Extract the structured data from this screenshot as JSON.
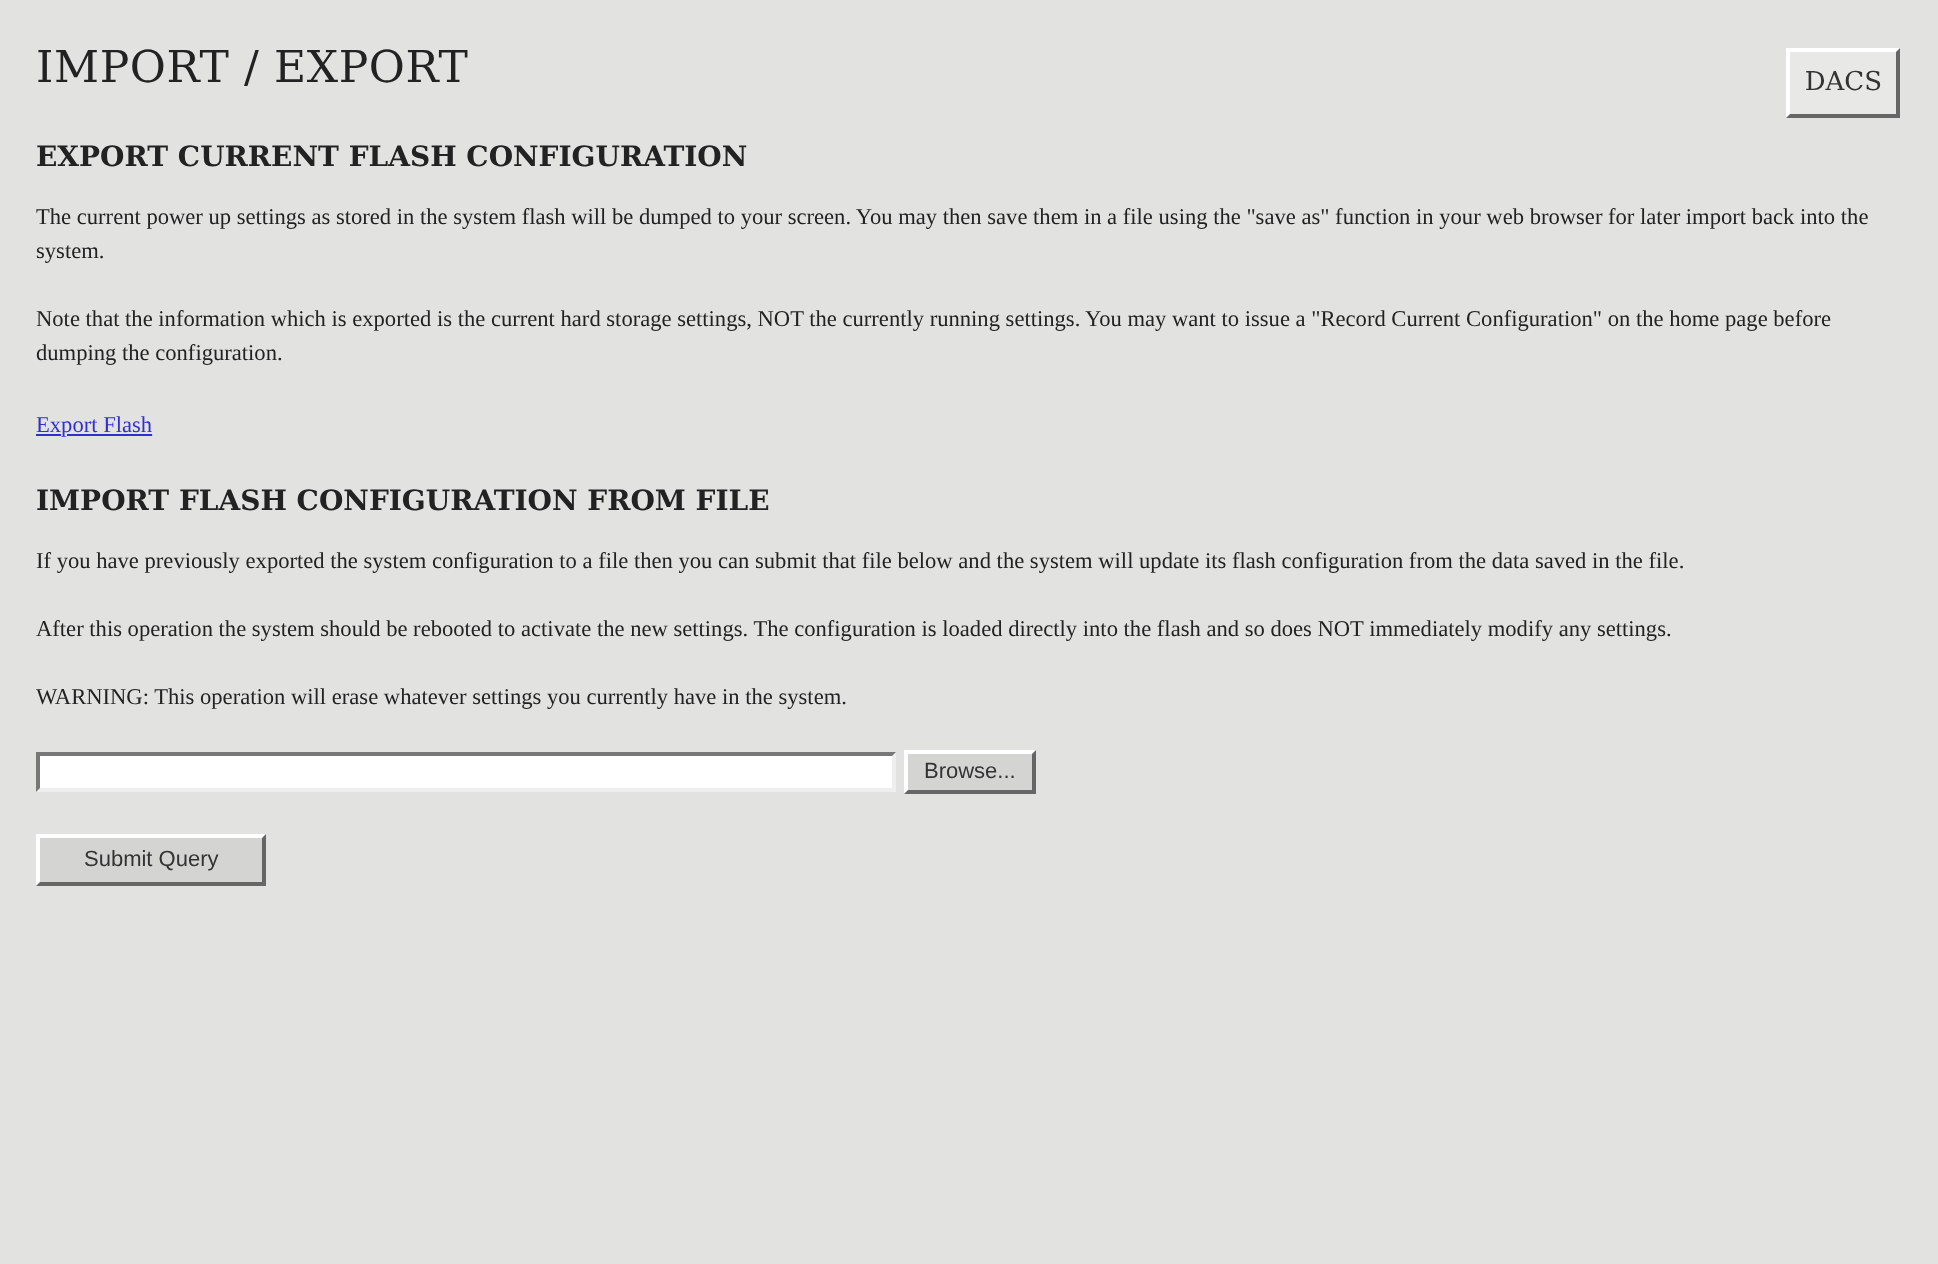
{
  "title": "IMPORT / EXPORT",
  "top_button": "DACS",
  "sections": [
    {
      "heading": "EXPORT CURRENT FLASH CONFIGURATION",
      "paragraphs": [
        "The current power up settings as stored in the system flash will be dumped to your screen. You may then save them in a file using the \"save as\" function in your web browser for later import back into the system.",
        "Note that the information which is exported is the current hard storage settings, NOT the currently running settings. You may want to issue a \"Record Current Configuration\" on the home page before dumping the configuration."
      ],
      "link": "Export Flash"
    },
    {
      "heading": "IMPORT FLASH CONFIGURATION FROM FILE",
      "paragraphs": [
        "If you have previously exported the system configuration to a file then you can submit that file below and the system will update its flash configuration from the data saved in the file.",
        "After this operation the system should be rebooted to activate the new settings. The configuration is loaded directly into the flash and so does NOT immediately modify any settings.",
        "WARNING: This operation will erase whatever settings you currently have in the system."
      ]
    }
  ],
  "file_input": {
    "button": "Browse..."
  },
  "submit_button": "Submit Query"
}
